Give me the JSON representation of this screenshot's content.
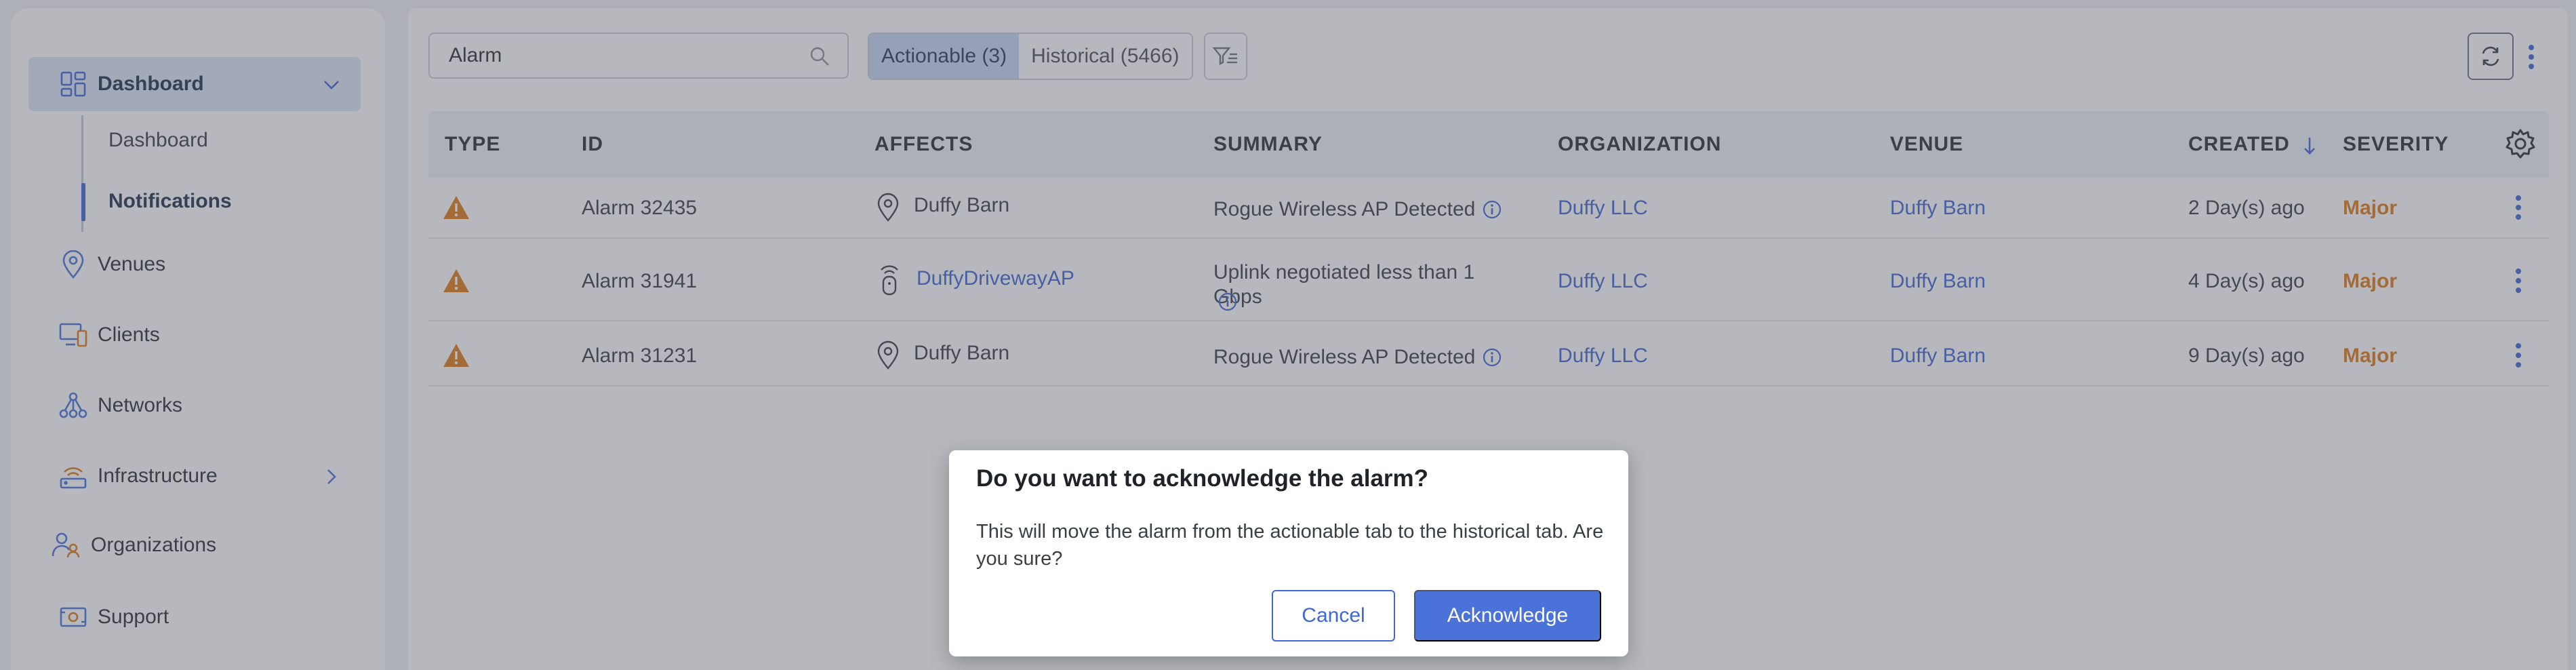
{
  "sidebar": {
    "items": [
      {
        "label": "Dashboard",
        "icon": "dashboard-icon"
      },
      {
        "label": "Venues",
        "icon": "location-pin-icon"
      },
      {
        "label": "Clients",
        "icon": "devices-icon"
      },
      {
        "label": "Networks",
        "icon": "network-icon"
      },
      {
        "label": "Infrastructure",
        "icon": "infrastructure-icon"
      },
      {
        "label": "Organizations",
        "icon": "organizations-icon"
      },
      {
        "label": "Support",
        "icon": "support-icon"
      }
    ],
    "sub_items": [
      {
        "label": "Dashboard"
      },
      {
        "label": "Notifications"
      }
    ]
  },
  "toolbar": {
    "search_value": "Alarm",
    "tabs": [
      {
        "label": "Actionable (3)"
      },
      {
        "label": "Historical (5466)"
      }
    ]
  },
  "table": {
    "columns": [
      "TYPE",
      "ID",
      "AFFECTS",
      "SUMMARY",
      "ORGANIZATION",
      "VENUE",
      "CREATED",
      "SEVERITY"
    ],
    "rows": [
      {
        "id": "Alarm 32435",
        "affects": "Duffy Barn",
        "summary": "Rogue Wireless AP Detected",
        "organization": "Duffy LLC",
        "venue": "Duffy Barn",
        "created": "2 Day(s) ago",
        "severity": "Major"
      },
      {
        "id": "Alarm 31941",
        "affects": "DuffyDrivewayAP",
        "summary": "Uplink negotiated less than 1 Gbps",
        "organization": "Duffy LLC",
        "venue": "Duffy Barn",
        "created": "4 Day(s) ago",
        "severity": "Major"
      },
      {
        "id": "Alarm 31231",
        "affects": "Duffy Barn",
        "summary": "Rogue Wireless AP Detected",
        "organization": "Duffy LLC",
        "venue": "Duffy Barn",
        "created": "9 Day(s) ago",
        "severity": "Major"
      }
    ]
  },
  "modal": {
    "title": "Do you want to acknowledge the alarm?",
    "body": "This will move the alarm from the actionable tab to the historical tab. Are you sure?",
    "cancel_label": "Cancel",
    "confirm_label": "Acknowledge"
  },
  "colors": {
    "accent": "#3f67d6",
    "warning": "#e07b18",
    "active_nav_bg": "#dde6f8"
  }
}
